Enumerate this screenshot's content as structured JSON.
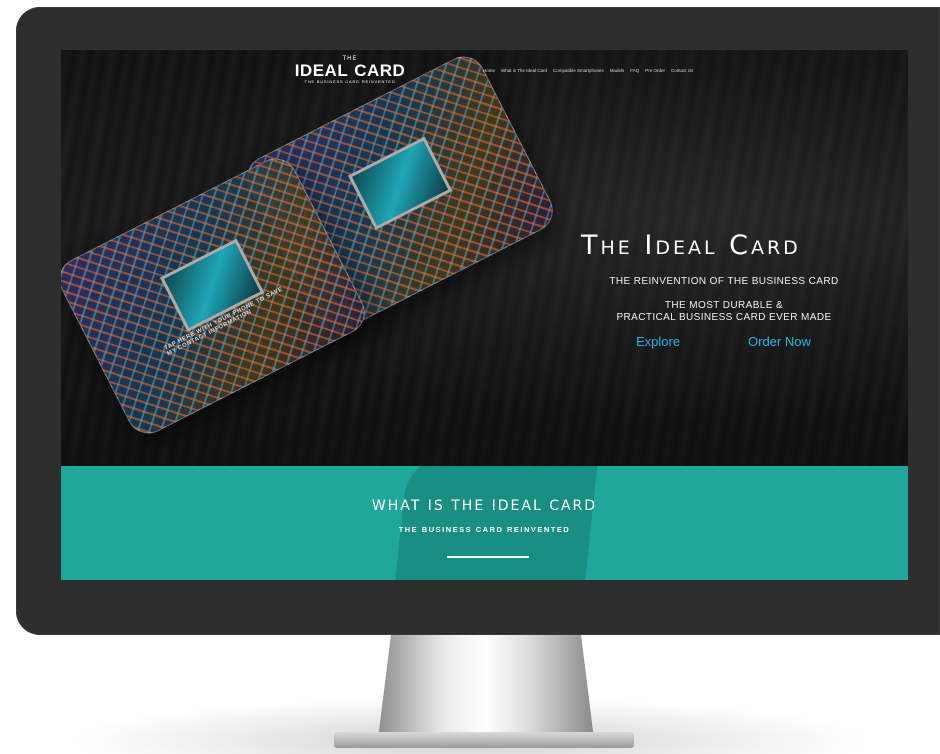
{
  "header": {
    "logo": {
      "the": "THE",
      "main_left": "IDEAL",
      "main_right": "CARD",
      "tagline": "THE BUSINESS CARD REINVENTED"
    },
    "nav": [
      "Home",
      "What is The Ideal Card",
      "Compatible Smartphones",
      "Models",
      "FAQ",
      "Pre Order",
      "Contact Us"
    ]
  },
  "hero": {
    "card_text": "TAP HERE WITH YOUR PHONE TO SAVE MY CONTACT INFORMATION",
    "title": "The Ideal Card",
    "subtitle": "THE REINVENTION OF THE BUSINESS CARD",
    "desc_line1": "THE MOST DURABLE &",
    "desc_line2": "PRACTICAL BUSINESS CARD EVER MADE",
    "cta_explore": "Explore",
    "cta_order": "Order Now"
  },
  "band": {
    "title": "WHAT IS THE IDEAL CARD",
    "subtitle": "THE BUSINESS CARD REINVENTED"
  },
  "colors": {
    "accent_teal": "#1fa79c",
    "cta_blue": "#1fb6e0",
    "bezel": "#2e2e2e"
  }
}
